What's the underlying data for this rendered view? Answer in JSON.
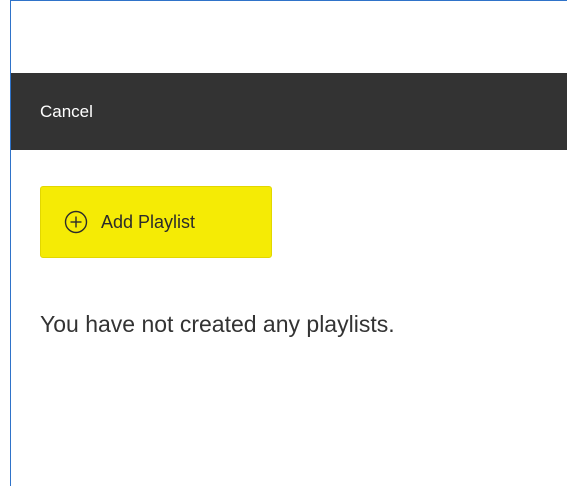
{
  "toolbar": {
    "cancel_label": "Cancel"
  },
  "add_playlist": {
    "label": "Add Playlist",
    "icon": "plus-circle-icon"
  },
  "empty_state": {
    "message": "You have not created any playlists."
  },
  "colors": {
    "toolbar_bg": "#333333",
    "button_bg": "#f5eb05",
    "frame_border": "#2f73c9"
  }
}
